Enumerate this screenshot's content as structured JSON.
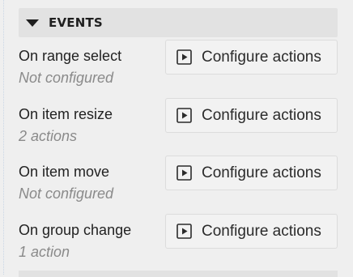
{
  "events_section": {
    "title": "EVENTS",
    "events": [
      {
        "label": "On range select",
        "status": "Not configured",
        "button": "Configure actions"
      },
      {
        "label": "On item resize",
        "status": "2 actions",
        "button": "Configure actions"
      },
      {
        "label": "On item move",
        "status": "Not configured",
        "button": "Configure actions"
      },
      {
        "label": "On group change",
        "status": "1 action",
        "button": "Configure actions"
      }
    ]
  }
}
